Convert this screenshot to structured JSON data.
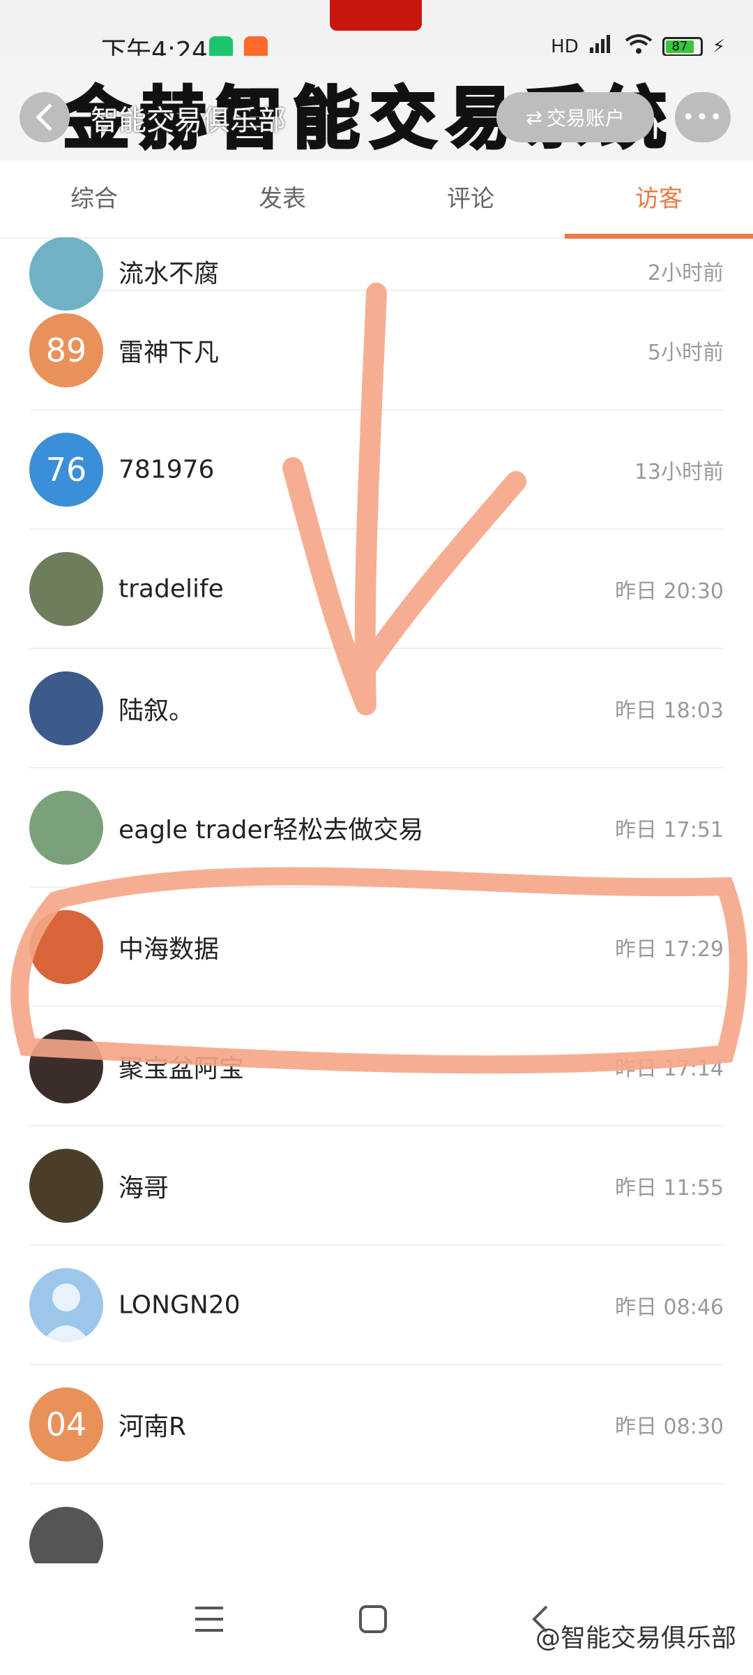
{
  "status_bar": {
    "time": "下午4:24",
    "network": "HD",
    "battery": "87"
  },
  "header": {
    "watermark_title": "金赫智能交易系统",
    "club_name": "智能交易俱乐部",
    "switch_label": "交易账户"
  },
  "tabs": [
    {
      "label": "综合"
    },
    {
      "label": "发表"
    },
    {
      "label": "评论"
    },
    {
      "label": "访客"
    }
  ],
  "active_tab": "访客",
  "visitors": [
    {
      "name": "流水不腐",
      "time": "2小时前",
      "avatar_text": "",
      "avatar_color": "#6fb2c4"
    },
    {
      "name": "雷神下凡",
      "time": "5小时前",
      "avatar_text": "89",
      "avatar_color": "#e8915a"
    },
    {
      "name": "781976",
      "time": "13小时前",
      "avatar_text": "76",
      "avatar_color": "#3b8fd8"
    },
    {
      "name": "tradelife",
      "time": "昨日 20:30",
      "avatar_text": "",
      "avatar_color": "#6e7d5c"
    },
    {
      "name": "陆叙。",
      "time": "昨日 18:03",
      "avatar_text": "",
      "avatar_color": "#3c5a8a"
    },
    {
      "name": "eagle trader轻松去做交易",
      "time": "昨日 17:51",
      "avatar_text": "",
      "avatar_color": "#7aa27a"
    },
    {
      "name": "中海数据",
      "time": "昨日 17:29",
      "avatar_text": "",
      "avatar_color": "#d8643a"
    },
    {
      "name": "聚宝盆阿宝",
      "time": "昨日 17:14",
      "avatar_text": "",
      "avatar_color": "#3a2d2a"
    },
    {
      "name": "海哥",
      "time": "昨日 11:55",
      "avatar_text": "",
      "avatar_color": "#4a3e2a"
    },
    {
      "name": "LONGN20",
      "time": "昨日 08:46",
      "avatar_text": "",
      "avatar_color": "#9cc6ea"
    },
    {
      "name": "河南R",
      "time": "昨日 08:30",
      "avatar_text": "04",
      "avatar_color": "#e8915a"
    },
    {
      "name": "",
      "time": "",
      "avatar_text": "",
      "avatar_color": "#555555"
    }
  ],
  "footer": {
    "watermark": "@智能交易俱乐部"
  },
  "colors": {
    "accent": "#ea7a45",
    "annotation": "#f5a586"
  }
}
